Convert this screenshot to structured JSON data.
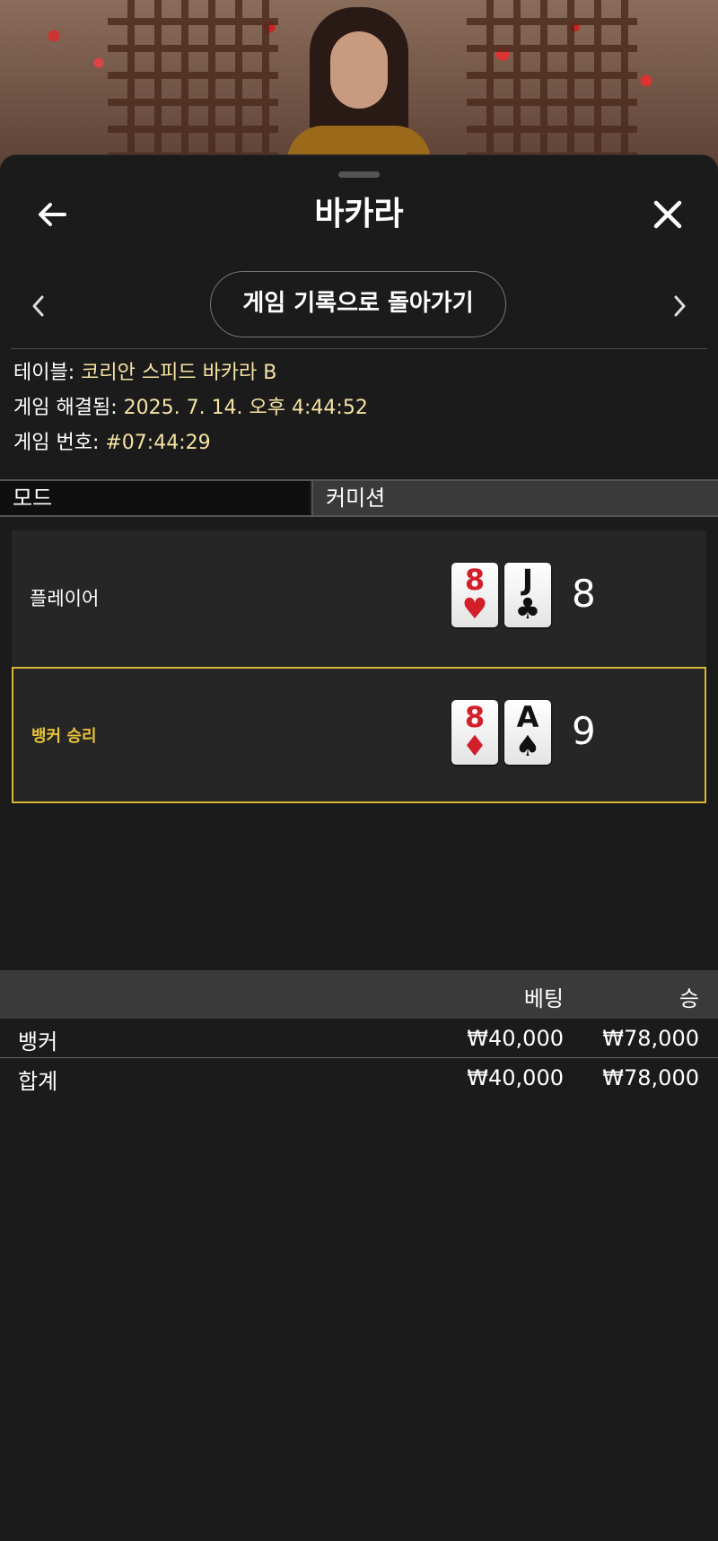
{
  "window": {
    "title": "바카라"
  },
  "nav": {
    "history_button": "게임 기록으로 돌아가기"
  },
  "info": {
    "table_label": "테이블: ",
    "table_value": "코리안 스피드 바카라 B",
    "resolved_label": "게임 해결됨: ",
    "resolved_value": "2025. 7. 14. 오후 4:44:52",
    "game_no_label": "게임 번호: ",
    "game_no_value": "#07:44:29"
  },
  "tabs": {
    "mode": "모드",
    "commission": "커미션"
  },
  "player": {
    "label": "플레이어",
    "cards": [
      {
        "rank": "8",
        "suit": "♥",
        "color": "#d21f2a"
      },
      {
        "rank": "J",
        "suit": "♣",
        "color": "#111111"
      }
    ],
    "score": "8"
  },
  "banker": {
    "label": "뱅커 승리",
    "cards": [
      {
        "rank": "8",
        "suit": "♦",
        "color": "#d21f2a"
      },
      {
        "rank": "A",
        "suit": "♠",
        "color": "#111111"
      }
    ],
    "score": "9"
  },
  "bets": {
    "headers": {
      "bet": "베팅",
      "win": "승"
    },
    "rows": [
      {
        "name": "뱅커",
        "bet": "₩40,000",
        "win": "₩78,000"
      },
      {
        "name": "합계",
        "bet": "₩40,000",
        "win": "₩78,000"
      }
    ]
  },
  "colors": {
    "accent_gold": "#e8c23a",
    "info_value": "#f6e3a3",
    "background": "#1b1b1b"
  },
  "icons": {
    "back": "arrow-left-icon",
    "close": "close-icon",
    "prev": "chevron-left-icon",
    "next": "chevron-right-icon"
  }
}
